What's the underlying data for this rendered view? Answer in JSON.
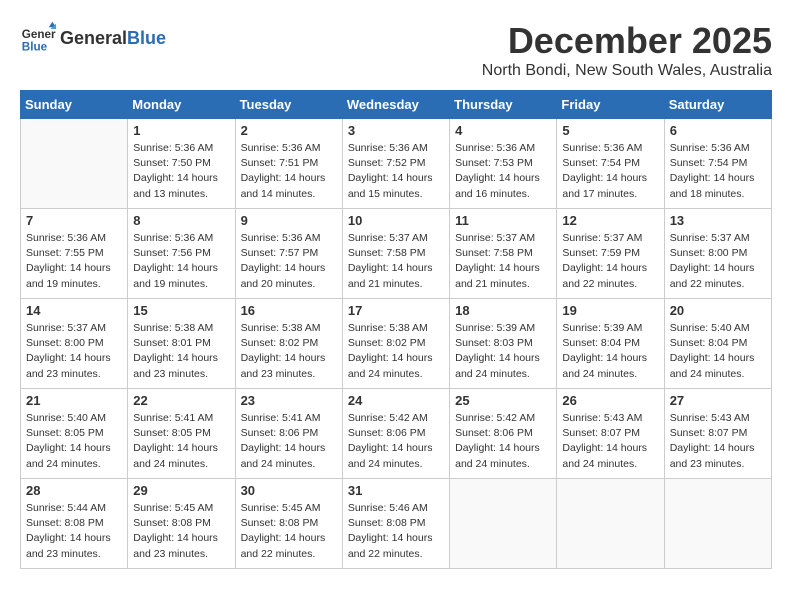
{
  "header": {
    "logo_general": "General",
    "logo_blue": "Blue",
    "month_title": "December 2025",
    "location": "North Bondi, New South Wales, Australia"
  },
  "days_of_week": [
    "Sunday",
    "Monday",
    "Tuesday",
    "Wednesday",
    "Thursday",
    "Friday",
    "Saturday"
  ],
  "weeks": [
    [
      {
        "day": "",
        "content": ""
      },
      {
        "day": "1",
        "content": "Sunrise: 5:36 AM\nSunset: 7:50 PM\nDaylight: 14 hours\nand 13 minutes."
      },
      {
        "day": "2",
        "content": "Sunrise: 5:36 AM\nSunset: 7:51 PM\nDaylight: 14 hours\nand 14 minutes."
      },
      {
        "day": "3",
        "content": "Sunrise: 5:36 AM\nSunset: 7:52 PM\nDaylight: 14 hours\nand 15 minutes."
      },
      {
        "day": "4",
        "content": "Sunrise: 5:36 AM\nSunset: 7:53 PM\nDaylight: 14 hours\nand 16 minutes."
      },
      {
        "day": "5",
        "content": "Sunrise: 5:36 AM\nSunset: 7:54 PM\nDaylight: 14 hours\nand 17 minutes."
      },
      {
        "day": "6",
        "content": "Sunrise: 5:36 AM\nSunset: 7:54 PM\nDaylight: 14 hours\nand 18 minutes."
      }
    ],
    [
      {
        "day": "7",
        "content": "Sunrise: 5:36 AM\nSunset: 7:55 PM\nDaylight: 14 hours\nand 19 minutes."
      },
      {
        "day": "8",
        "content": "Sunrise: 5:36 AM\nSunset: 7:56 PM\nDaylight: 14 hours\nand 19 minutes."
      },
      {
        "day": "9",
        "content": "Sunrise: 5:36 AM\nSunset: 7:57 PM\nDaylight: 14 hours\nand 20 minutes."
      },
      {
        "day": "10",
        "content": "Sunrise: 5:37 AM\nSunset: 7:58 PM\nDaylight: 14 hours\nand 21 minutes."
      },
      {
        "day": "11",
        "content": "Sunrise: 5:37 AM\nSunset: 7:58 PM\nDaylight: 14 hours\nand 21 minutes."
      },
      {
        "day": "12",
        "content": "Sunrise: 5:37 AM\nSunset: 7:59 PM\nDaylight: 14 hours\nand 22 minutes."
      },
      {
        "day": "13",
        "content": "Sunrise: 5:37 AM\nSunset: 8:00 PM\nDaylight: 14 hours\nand 22 minutes."
      }
    ],
    [
      {
        "day": "14",
        "content": "Sunrise: 5:37 AM\nSunset: 8:00 PM\nDaylight: 14 hours\nand 23 minutes."
      },
      {
        "day": "15",
        "content": "Sunrise: 5:38 AM\nSunset: 8:01 PM\nDaylight: 14 hours\nand 23 minutes."
      },
      {
        "day": "16",
        "content": "Sunrise: 5:38 AM\nSunset: 8:02 PM\nDaylight: 14 hours\nand 23 minutes."
      },
      {
        "day": "17",
        "content": "Sunrise: 5:38 AM\nSunset: 8:02 PM\nDaylight: 14 hours\nand 24 minutes."
      },
      {
        "day": "18",
        "content": "Sunrise: 5:39 AM\nSunset: 8:03 PM\nDaylight: 14 hours\nand 24 minutes."
      },
      {
        "day": "19",
        "content": "Sunrise: 5:39 AM\nSunset: 8:04 PM\nDaylight: 14 hours\nand 24 minutes."
      },
      {
        "day": "20",
        "content": "Sunrise: 5:40 AM\nSunset: 8:04 PM\nDaylight: 14 hours\nand 24 minutes."
      }
    ],
    [
      {
        "day": "21",
        "content": "Sunrise: 5:40 AM\nSunset: 8:05 PM\nDaylight: 14 hours\nand 24 minutes."
      },
      {
        "day": "22",
        "content": "Sunrise: 5:41 AM\nSunset: 8:05 PM\nDaylight: 14 hours\nand 24 minutes."
      },
      {
        "day": "23",
        "content": "Sunrise: 5:41 AM\nSunset: 8:06 PM\nDaylight: 14 hours\nand 24 minutes."
      },
      {
        "day": "24",
        "content": "Sunrise: 5:42 AM\nSunset: 8:06 PM\nDaylight: 14 hours\nand 24 minutes."
      },
      {
        "day": "25",
        "content": "Sunrise: 5:42 AM\nSunset: 8:06 PM\nDaylight: 14 hours\nand 24 minutes."
      },
      {
        "day": "26",
        "content": "Sunrise: 5:43 AM\nSunset: 8:07 PM\nDaylight: 14 hours\nand 24 minutes."
      },
      {
        "day": "27",
        "content": "Sunrise: 5:43 AM\nSunset: 8:07 PM\nDaylight: 14 hours\nand 23 minutes."
      }
    ],
    [
      {
        "day": "28",
        "content": "Sunrise: 5:44 AM\nSunset: 8:08 PM\nDaylight: 14 hours\nand 23 minutes."
      },
      {
        "day": "29",
        "content": "Sunrise: 5:45 AM\nSunset: 8:08 PM\nDaylight: 14 hours\nand 23 minutes."
      },
      {
        "day": "30",
        "content": "Sunrise: 5:45 AM\nSunset: 8:08 PM\nDaylight: 14 hours\nand 22 minutes."
      },
      {
        "day": "31",
        "content": "Sunrise: 5:46 AM\nSunset: 8:08 PM\nDaylight: 14 hours\nand 22 minutes."
      },
      {
        "day": "",
        "content": ""
      },
      {
        "day": "",
        "content": ""
      },
      {
        "day": "",
        "content": ""
      }
    ]
  ]
}
